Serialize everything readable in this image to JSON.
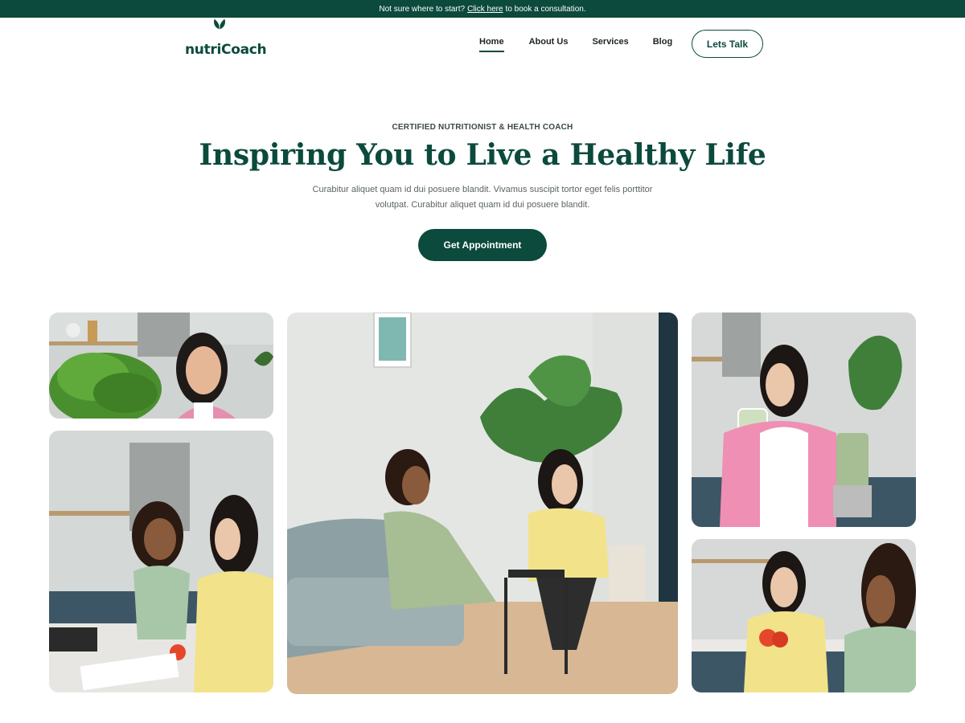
{
  "topbar": {
    "text": "Not sure where to start?",
    "link": "Click here",
    "suffix": "to book a consultation."
  },
  "brand": {
    "name": "nutriCoach",
    "color": "#0b4a3c"
  },
  "nav": {
    "items": [
      "Home",
      "About Us",
      "Services",
      "Blog"
    ],
    "active": "Home",
    "cta": "Lets Talk"
  },
  "hero": {
    "eyebrow": "CERTIFIED NUTRITIONIST & HEALTH COACH",
    "title": "Inspiring You to Live a Healthy Life",
    "description_line1": "Curabitur aliquet quam id dui posuere blandit. Vivamus suscipit tortor eget felis porttitor",
    "description_line2": "volutpat. Curabitur aliquet quam id dui posuere blandit.",
    "cta": "Get Appointment"
  },
  "gallery": {
    "photos": [
      "woman-with-lettuce-photo",
      "two-women-kitchen-counter-photo",
      "consultation-living-room-photo",
      "woman-drinking-smoothie-photo",
      "women-holding-tomatoes-photo"
    ]
  }
}
